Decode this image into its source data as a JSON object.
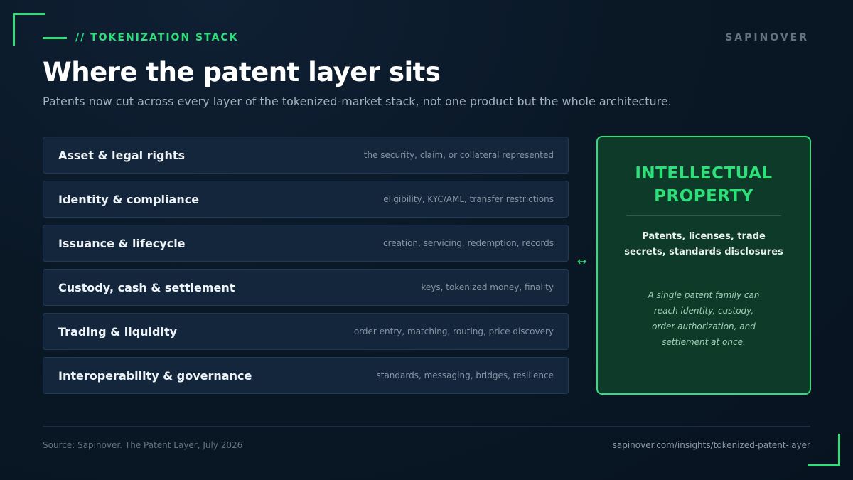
{
  "header": {
    "eyebrow": "// TOKENIZATION STACK",
    "brand": "SAPINOVER",
    "title": "Where the patent layer sits",
    "subtitle": "Patents now cut across every layer of the tokenized-market stack, not one product but the whole architecture."
  },
  "layers": [
    {
      "name": "Asset & legal rights",
      "desc": "the security, claim, or collateral represented"
    },
    {
      "name": "Identity & compliance",
      "desc": "eligibility, KYC/AML, transfer restrictions"
    },
    {
      "name": "Issuance & lifecycle",
      "desc": "creation, servicing, redemption, records"
    },
    {
      "name": "Custody, cash & settlement",
      "desc": "keys, tokenized money, finality"
    },
    {
      "name": "Trading & liquidity",
      "desc": "order entry, matching, routing, price discovery"
    },
    {
      "name": "Interoperability & governance",
      "desc": "standards, messaging, bridges, resilience"
    }
  ],
  "connector": {
    "glyph": "↔"
  },
  "ip_card": {
    "title_line1": "INTELLECTUAL",
    "title_line2": "PROPERTY",
    "sub_line1": "Patents, licenses, trade",
    "sub_line2": "secrets, standards disclosures",
    "note_line1": "A single patent family can",
    "note_line2": "reach identity, custody,",
    "note_line3": "order authorization, and",
    "note_line4": "settlement at once."
  },
  "footer": {
    "source": "Source: Sapinover. The Patent Layer, July 2026",
    "url": "sapinover.com/insights/tokenized-patent-layer"
  },
  "colors": {
    "accent": "#2ee07a",
    "background": "#0a1826",
    "layer_bg": "#13263c",
    "card_bg": "#0d3a29"
  }
}
